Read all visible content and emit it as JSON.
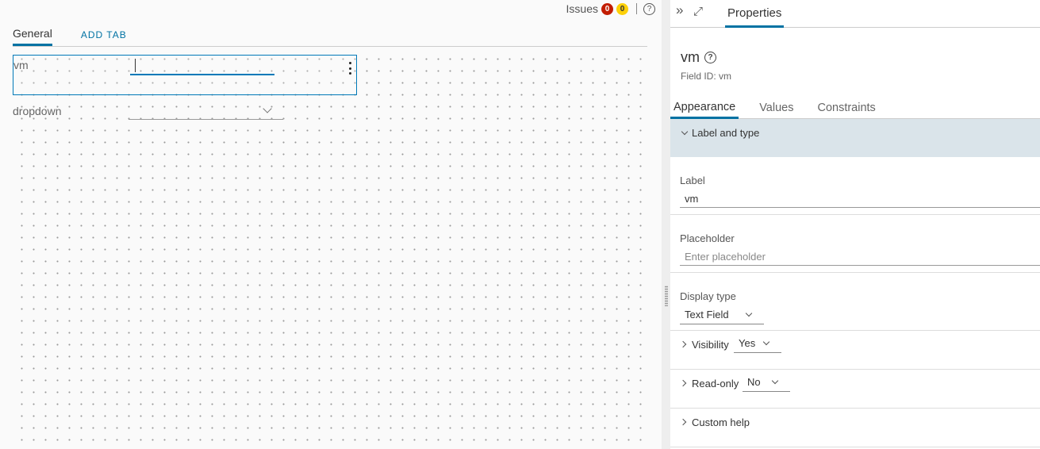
{
  "issues": {
    "label": "Issues",
    "error_count": "0",
    "warning_count": "0",
    "help_glyph": "?"
  },
  "form_tabs": {
    "general": "General",
    "add_tab": "ADD TAB"
  },
  "canvas_fields": {
    "vm_label": "vm",
    "dropdown_label": "dropdown"
  },
  "panel": {
    "collapse_glyph": "»",
    "expand_glyph": "⤢",
    "properties_tab": "Properties",
    "title": "vm",
    "title_help_glyph": "?",
    "field_id": "Field ID: vm",
    "sub_tabs": [
      "Appearance",
      "Values",
      "Constraints"
    ],
    "section_label_type": "Label and type",
    "label_caption": "Label",
    "label_value": "vm",
    "placeholder_caption": "Placeholder",
    "placeholder_hint": "Enter placeholder",
    "display_type_caption": "Display type",
    "display_type_value": "Text Field",
    "visibility_caption": "Visibility",
    "visibility_value": "Yes",
    "readonly_caption": "Read-only",
    "readonly_value": "No",
    "custom_help_caption": "Custom help"
  },
  "colors": {
    "accent": "#0072a3",
    "error_badge": "#c21d00",
    "warning_badge": "#fdd008",
    "section_header_bg": "#dae4ea"
  }
}
